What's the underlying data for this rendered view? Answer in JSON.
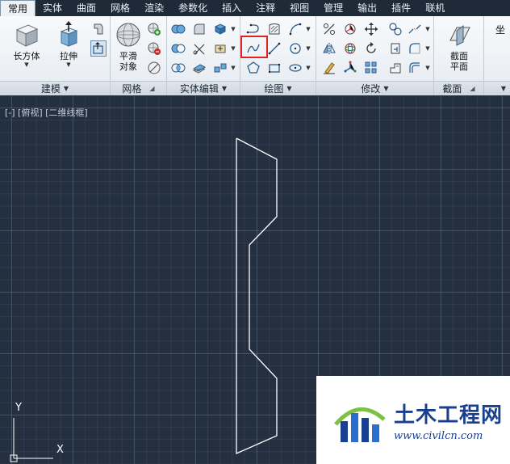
{
  "menu": {
    "tabs": [
      "常用",
      "实体",
      "曲面",
      "网格",
      "渲染",
      "参数化",
      "插入",
      "注释",
      "视图",
      "管理",
      "输出",
      "插件",
      "联机"
    ]
  },
  "ribbon": {
    "modeling": {
      "title": "建模",
      "box_label": "长方体",
      "extrude_label": "拉伸"
    },
    "mesh": {
      "title": "网格",
      "smooth_label_1": "平滑",
      "smooth_label_2": "对象"
    },
    "solid_edit": {
      "title": "实体编辑"
    },
    "draw": {
      "title": "绘图"
    },
    "modify": {
      "title": "修改"
    },
    "section": {
      "title": "截面",
      "plane_label_1": "截面",
      "plane_label_2": "平面"
    },
    "coords": {
      "label": "坐"
    }
  },
  "viewport": {
    "label": "[-] [俯视] [二维线框]",
    "ucs_y": "Y",
    "ucs_x": "X"
  },
  "watermark": {
    "title": "土木工程网",
    "url": "www.civilcn.com"
  },
  "colors": {
    "canvas_bg": "#243040",
    "highlight": "#e0231f",
    "watermark_text": "#1a3f8f"
  }
}
